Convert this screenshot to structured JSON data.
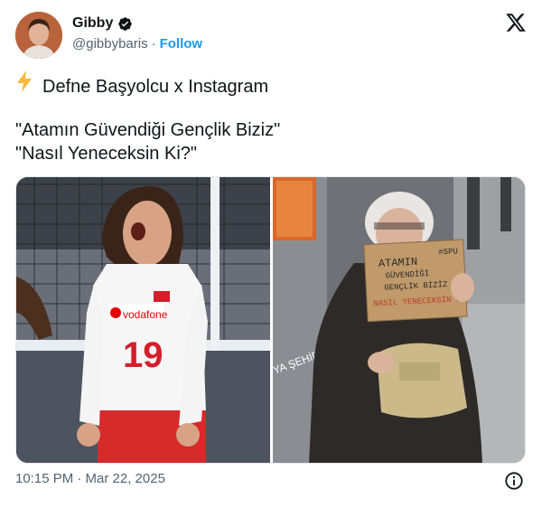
{
  "author": {
    "display_name": "Gibby",
    "handle": "@gibbybaris",
    "separator": "·",
    "follow_label": "Follow"
  },
  "tweet": {
    "line1_emoji": "⚡",
    "line1_text": "Defne Başyolcu x Instagram",
    "line2": "\"Atamın Güvendiği Gençlik Biziz\"",
    "line3": "\"Nasıl Yeneceksin Ki?\""
  },
  "media": {
    "left_photo": {
      "jersey_brand": "vodafone",
      "jersey_number": "19"
    },
    "right_photo": {
      "sign_line1": "ATAMIN",
      "sign_line2": "GÜVENDİĞİ",
      "sign_line3": "GENÇLİK BİZİZ",
      "sign_line4": "NASIL YENECEKSİN Kİ",
      "sign_tag": "#SPU",
      "wall_text": "YA ŞEHİR"
    }
  },
  "meta": {
    "timestamp": "10:15 PM · Mar 22, 2025"
  },
  "icons": {
    "verified": "verified-badge-icon",
    "x_logo": "x-logo-icon",
    "info": "info-icon"
  },
  "colors": {
    "link": "#1d9bf0",
    "text": "#0f1419",
    "muted": "#536471"
  }
}
